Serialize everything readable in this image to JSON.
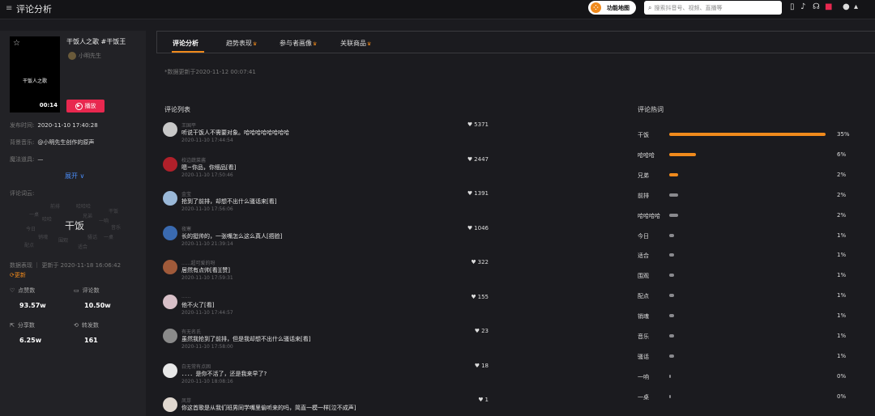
{
  "topbar": {
    "title": "评论分析",
    "func_label": "功能地图",
    "search_placeholder": "搜索抖音号、视频、直播等"
  },
  "video": {
    "title": "干饭人之歌 #干饭王",
    "author": "小明先生",
    "thumb_text": "干饭人之歌",
    "duration": "00:14",
    "play_label": "播放",
    "publish_label": "发布时间:",
    "publish_value": "2020-11-10 17:40:28",
    "music_label": "背景音乐:",
    "music_value": "@小明先生创作的原声",
    "prop_label": "魔法道具:",
    "prop_value": "—",
    "expand_label": "展开 ∨",
    "cloud_label": "评论词云:",
    "cloud_main": "干饭",
    "data_label": "数据表现 ｜ 更新于 2020-11-18 16:06:42",
    "refresh_label": "⟳更新"
  },
  "stats": [
    {
      "label": "点赞数",
      "value": "93.57w",
      "icon": "heart-icon"
    },
    {
      "label": "评论数",
      "value": "10.50w",
      "icon": "comment-icon"
    },
    {
      "label": "分享数",
      "value": "6.25w",
      "icon": "share-icon"
    },
    {
      "label": "转发数",
      "value": "161",
      "icon": "repost-icon"
    }
  ],
  "tabs": [
    {
      "label": "评论分析",
      "crown": ""
    },
    {
      "label": "趋势表现",
      "crown": "♛"
    },
    {
      "label": "参与者画像",
      "crown": "♛"
    },
    {
      "label": "关联商品",
      "crown": "♛"
    }
  ],
  "updated_text": "*数据更新于2020-11-12 00:07:41",
  "comments_title": "评论列表",
  "keywords_title": "评论热词",
  "comments": [
    {
      "name": "王国平",
      "text": "听说干饭人不需要对象。哈哈哈哈哈哈哈哈",
      "time": "2020-11-10 17:44:54",
      "likes": "5371",
      "avatar_color": "#c8c8c8"
    },
    {
      "name": "校边蔬菜酱",
      "text": "嗯~你品，你细品[看]",
      "time": "2020-11-10 17:50:46",
      "likes": "2447",
      "avatar_color": "#b0202a"
    },
    {
      "name": "金宝",
      "text": "抢到了前排，却想不出什么骚话来[看]",
      "time": "2020-11-10 17:56:06",
      "likes": "1391",
      "avatar_color": "#9ab8d8"
    },
    {
      "name": "夜寒",
      "text": "长的挺帅的，一张嘴怎么这么真人[捂脸]",
      "time": "2020-11-10 21:39:14",
      "likes": "1046",
      "avatar_color": "#3a6ab0"
    },
    {
      "name": "......超可爱的呀",
      "text": "居然有点帅[看][赞]",
      "time": "2020-11-10 17:59:31",
      "likes": "322",
      "avatar_color": "#a05a3a"
    },
    {
      "name": "......",
      "text": "他不火了[看]",
      "time": "2020-11-10 17:44:57",
      "likes": "155",
      "avatar_color": "#d8c0c8"
    },
    {
      "name": "有无名氏",
      "text": "虽然我抢到了前排，但是我却想不出什么骚话来[看]",
      "time": "2020-11-10 17:58:00",
      "likes": "23",
      "avatar_color": "#8a8a8a"
    },
    {
      "name": "白无常有点困",
      "text": "．．．．是你不活了，还是我来早了?",
      "time": "2020-11-10 18:08:16",
      "likes": "18",
      "avatar_color": "#e8e8e8"
    },
    {
      "name": "凤芽",
      "text": "你这首歌是从我们班男同学嘴里偷听来的吗，简直一模一样[泣不成声]",
      "time": "",
      "likes": "1",
      "avatar_color": "#e0d8d0"
    }
  ],
  "keywords": [
    {
      "label": "干饭",
      "pct": "35%",
      "value": 35,
      "color": "#f08a1c"
    },
    {
      "label": "哈哈哈",
      "pct": "6%",
      "value": 6,
      "color": "#f08a1c"
    },
    {
      "label": "兄弟",
      "pct": "2%",
      "value": 2,
      "color": "#f08a1c"
    },
    {
      "label": "前排",
      "pct": "2%",
      "value": 2,
      "color": "#8a8a8e"
    },
    {
      "label": "哈哈哈哈",
      "pct": "2%",
      "value": 2,
      "color": "#8a8a8e"
    },
    {
      "label": "今日",
      "pct": "1%",
      "value": 1,
      "color": "#8a8a8e"
    },
    {
      "label": "适合",
      "pct": "1%",
      "value": 1,
      "color": "#8a8a8e"
    },
    {
      "label": "围观",
      "pct": "1%",
      "value": 1,
      "color": "#8a8a8e"
    },
    {
      "label": "配点",
      "pct": "1%",
      "value": 1,
      "color": "#8a8a8e"
    },
    {
      "label": "销魂",
      "pct": "1%",
      "value": 1,
      "color": "#8a8a8e"
    },
    {
      "label": "音乐",
      "pct": "1%",
      "value": 1,
      "color": "#8a8a8e"
    },
    {
      "label": "骚话",
      "pct": "1%",
      "value": 1,
      "color": "#8a8a8e"
    },
    {
      "label": "一响",
      "pct": "0%",
      "value": 0,
      "color": "#8a8a8e"
    },
    {
      "label": "一桌",
      "pct": "0%",
      "value": 0,
      "color": "#8a8a8e"
    }
  ]
}
